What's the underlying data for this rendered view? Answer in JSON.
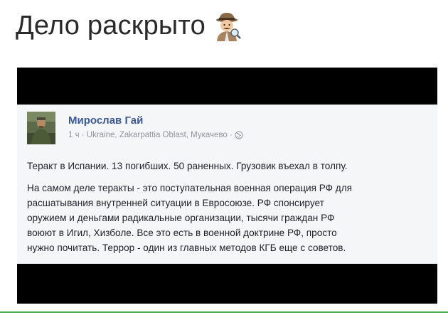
{
  "header": {
    "title": "Дело раскрыто"
  },
  "post": {
    "author_name": "Мирослав Гай",
    "meta_text": "1 ч · Ukraine, Zakarpattia Oblast, Мукачево ·",
    "paragraph1": "Теракт в Испании. 13 погибших. 50 раненных. Грузовик въехал в толпу.",
    "paragraph2_lines": [
      "На самом деле теракты - это поступательная военная операция РФ для",
      "расшатывания внутренней ситуации в Евросоюзе. РФ спонсирует",
      "оружием и деньгами радикальные организации, тысячи граждан РФ",
      "воюют в Игил, Хизболе. Все это есть в военной доктрине РФ, просто",
      "нужно почитать. Террор - один из главных методов КГБ еще с советов."
    ]
  },
  "icons": {
    "title_emoji": "detective-icon",
    "privacy": "globe-icon"
  },
  "colors": {
    "author_link": "#3b5998",
    "post_background": "#f5f6f7",
    "frame": "#000000",
    "meta_text": "#90949c",
    "bottom_rule": "#4caf50"
  }
}
